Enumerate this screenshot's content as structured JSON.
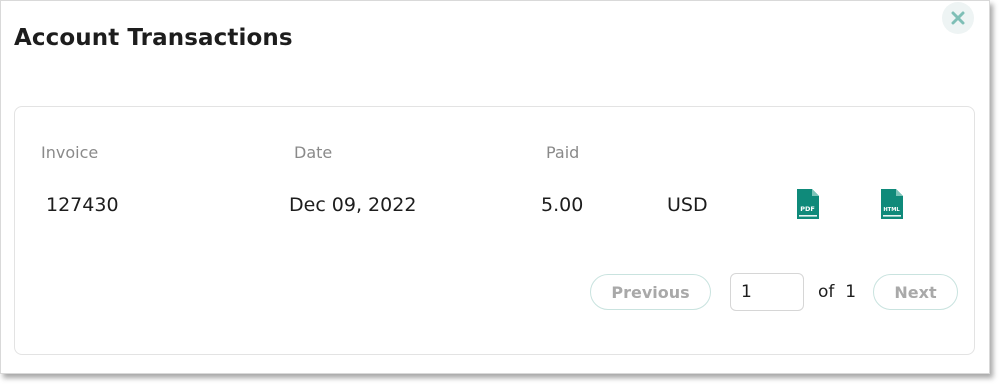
{
  "modal": {
    "title": "Account Transactions",
    "close_icon": "close-icon"
  },
  "table": {
    "headers": {
      "invoice": "Invoice",
      "date": "Date",
      "paid": "Paid"
    },
    "rows": [
      {
        "invoice": "127430",
        "date": "Dec 09, 2022",
        "paid": "5.00",
        "currency": "USD",
        "pdf_icon_label": "PDF",
        "html_icon_label": "HTML"
      }
    ]
  },
  "pagination": {
    "previous_label": "Previous",
    "page_value": "1",
    "of_label": "of",
    "total_pages": "1",
    "next_label": "Next"
  },
  "colors": {
    "accent": "#0f8a7a",
    "close_x": "#7fbfb6",
    "muted_text": "#a9a9a9"
  }
}
